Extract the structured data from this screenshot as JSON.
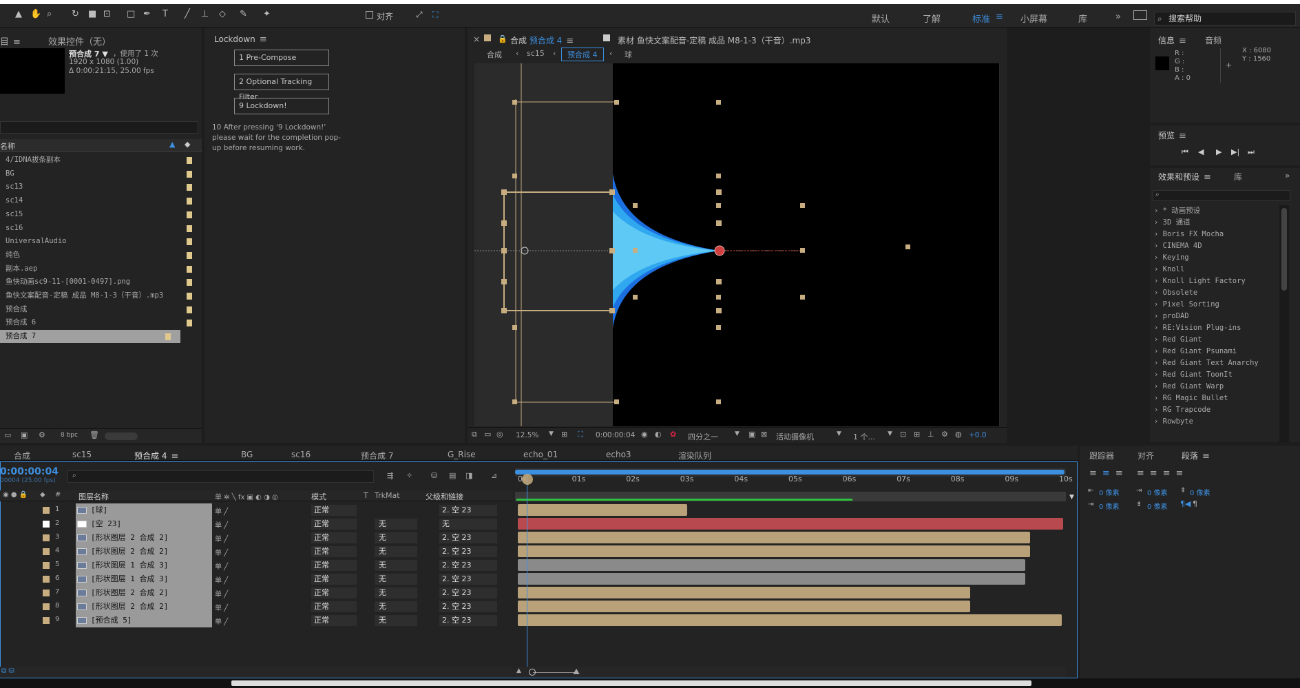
{
  "toolbar": {
    "snap_label": "对齐",
    "workspaces": [
      "默认",
      "了解",
      "标准",
      "小屏幕",
      "库"
    ],
    "active_workspace": "标准",
    "search_placeholder": "搜索帮助"
  },
  "project_panel": {
    "tab_label": "目",
    "effects_tab": "效果控件（无）",
    "comp_name": "预合成 7 ▼",
    "used_count": "，使用了 1 次",
    "resolution": "1920 x 1080 (1.00)",
    "duration": "Δ 0:00:21:15, 25.00 fps",
    "column_name": "名称",
    "items": [
      "4/IDNA拔条副本",
      "BG",
      "sc13",
      "sc14",
      "sc15",
      "sc16",
      "UniversalAudio",
      "纯色",
      "副本.aep",
      "鱼快动画sc9-11-[0001-0497].png",
      "鱼快文案配音-定稿 成品 M8-1-3（干音）.mp3",
      "预合成",
      "预合成 6",
      "预合成 7"
    ],
    "bpc": "8 bpc"
  },
  "lockdown_panel": {
    "title": "Lockdown",
    "buttons": [
      "1 Pre-Compose",
      "2 Optional Tracking Filter",
      "9 Lockdown!"
    ],
    "note": "10 After pressing '9 Lockdown!' please wait for the completion pop-up before resuming work."
  },
  "viewer": {
    "comp_tab_prefix": "合成",
    "comp_tab_name": "预合成 4",
    "footage_tab": "素材 鱼快文案配音-定稿 成品 M8-1-3（干音）.mp3",
    "breadcrumbs": [
      "合成",
      "sc15",
      "预合成 4",
      "球"
    ],
    "zoom": "12.5%",
    "timecode": "0:00:00:04",
    "resolution": "四分之一",
    "camera": "活动摄像机",
    "views": "1 个...",
    "exposure": "+0.0"
  },
  "info_panel": {
    "tab": "信息",
    "tab2": "音频",
    "r": "R :",
    "g": "G :",
    "b": "B :",
    "a": "A : 0",
    "x": "X : 6080",
    "y": "Y : 1560"
  },
  "preview_panel": {
    "title": "预览"
  },
  "effects_panel": {
    "title": "效果和预设",
    "tab2": "库",
    "items": [
      "* 动画预设",
      "3D 通道",
      "Boris FX Mocha",
      "CINEMA 4D",
      "Keying",
      "Knoll",
      "Knoll Light Factory",
      "Obsolete",
      "Pixel Sorting",
      "proDAD",
      "RE:Vision Plug-ins",
      "Red Giant",
      "Red Giant Psunami",
      "Red Giant Text Anarchy",
      "Red Giant ToonIt",
      "Red Giant Warp",
      "RG Magic Bullet",
      "RG Trapcode",
      "Rowbyte"
    ]
  },
  "timeline": {
    "tabs": [
      "合成",
      "sc15",
      "预合成 4",
      "BG",
      "sc16",
      "预合成 7",
      "G_Rise",
      "echo_01",
      "echo3",
      "渲染队列"
    ],
    "active_tab": "预合成 4",
    "timecode": "0:00:00:04",
    "fps_note": "00004 (25.00 fps)",
    "columns": {
      "name": "图层名称",
      "mode": "模式",
      "t": "T",
      "trkmat": "TrkMat",
      "parent": "父级和链接"
    },
    "ruler": [
      "0s",
      "01s",
      "02s",
      "03s",
      "04s",
      "05s",
      "06s",
      "07s",
      "08s",
      "09s",
      "10s"
    ],
    "layers": [
      {
        "num": "1",
        "name": "[球]",
        "mode": "正常",
        "trk": "",
        "parent": "2. 空 23",
        "color": "#b9a27a",
        "end": 0.31
      },
      {
        "num": "2",
        "name": "[空 23]",
        "mode": "正常",
        "trk": "无",
        "parent": "无",
        "color": "#b84a4f",
        "end": 1.0
      },
      {
        "num": "3",
        "name": "[形状图层 2 合成 2]",
        "mode": "正常",
        "trk": "无",
        "parent": "2. 空 23",
        "color": "#b9a27a",
        "end": 0.94
      },
      {
        "num": "4",
        "name": "[形状图层 2 合成 2]",
        "mode": "正常",
        "trk": "无",
        "parent": "2. 空 23",
        "color": "#b9a27a",
        "end": 0.94
      },
      {
        "num": "5",
        "name": "[形状图层 1 合成 3]",
        "mode": "正常",
        "trk": "无",
        "parent": "2. 空 23",
        "color": "#8a8a8a",
        "end": 0.93
      },
      {
        "num": "6",
        "name": "[形状图层 1 合成 3]",
        "mode": "正常",
        "trk": "无",
        "parent": "2. 空 23",
        "color": "#8a8a8a",
        "end": 0.93
      },
      {
        "num": "7",
        "name": "[形状图层 2 合成 2]",
        "mode": "正常",
        "trk": "无",
        "parent": "2. 空 23",
        "color": "#b9a27a",
        "end": 0.83
      },
      {
        "num": "8",
        "name": "[形状图层 2 合成 2]",
        "mode": "正常",
        "trk": "无",
        "parent": "2. 空 23",
        "color": "#b9a27a",
        "end": 0.83
      },
      {
        "num": "9",
        "name": "[预合成 5]",
        "mode": "正常",
        "trk": "无",
        "parent": "2. 空 23",
        "color": "#b9a27a",
        "end": 0.998
      }
    ]
  },
  "right_bottom": {
    "tabs": [
      "跟踪器",
      "对齐",
      "段落"
    ],
    "active": "段落",
    "fields": [
      "0 像素",
      "0 像素",
      "0 像素",
      "0 像素",
      "0 像素"
    ]
  }
}
